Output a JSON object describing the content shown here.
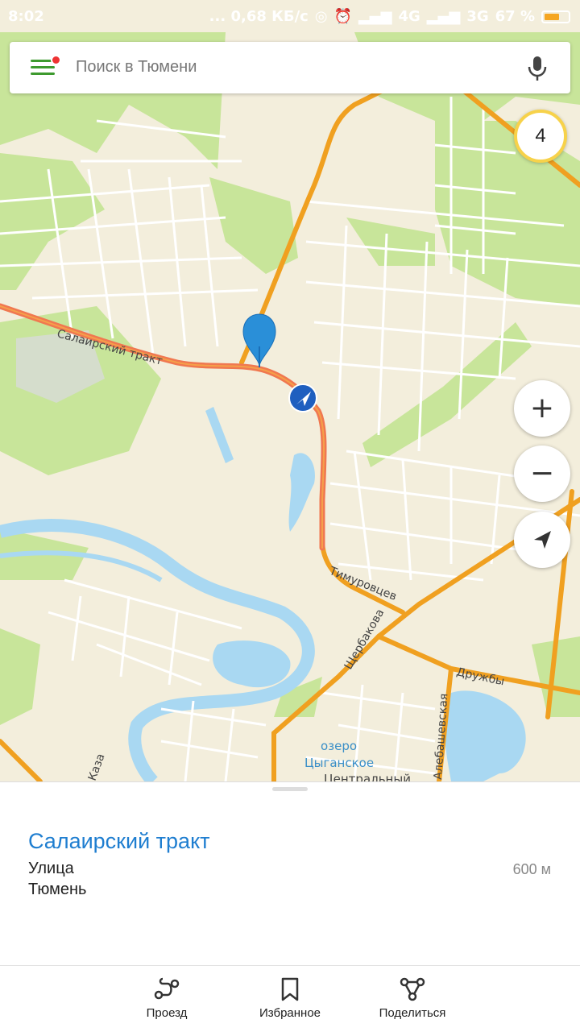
{
  "status_bar": {
    "time": "8:02",
    "network": "... 0,68 КБ/с",
    "signal_1": "4G",
    "signal_2": "3G",
    "battery": "67 %"
  },
  "search": {
    "placeholder": "Поиск в Тюмени"
  },
  "traffic": {
    "level": "4"
  },
  "map": {
    "labels": {
      "salairsky": "Салаирский тракт",
      "timurovtsev": "Тимуровцев",
      "shcherbakova": "Щербакова",
      "druzhby": "Дружбы",
      "alebashevskaya": "Алебашевская",
      "lake_1": "озеро",
      "lake_2": "Цыганское",
      "district": "Центральный",
      "kaz": "Каза"
    },
    "colors": {
      "water": "#a9d8f2",
      "green": "#c8e59a",
      "road_major": "#f0a020",
      "traffic": "#f07850",
      "street": "#ffffff",
      "base": "#f3eedc"
    }
  },
  "zoom": {
    "in": "+",
    "out": "−"
  },
  "place": {
    "name": "Салаирский тракт",
    "type": "Улица",
    "city": "Тюмень",
    "distance": "600 м"
  },
  "tabs": {
    "route": "Проезд",
    "favorites": "Избранное",
    "share": "Поделиться"
  }
}
